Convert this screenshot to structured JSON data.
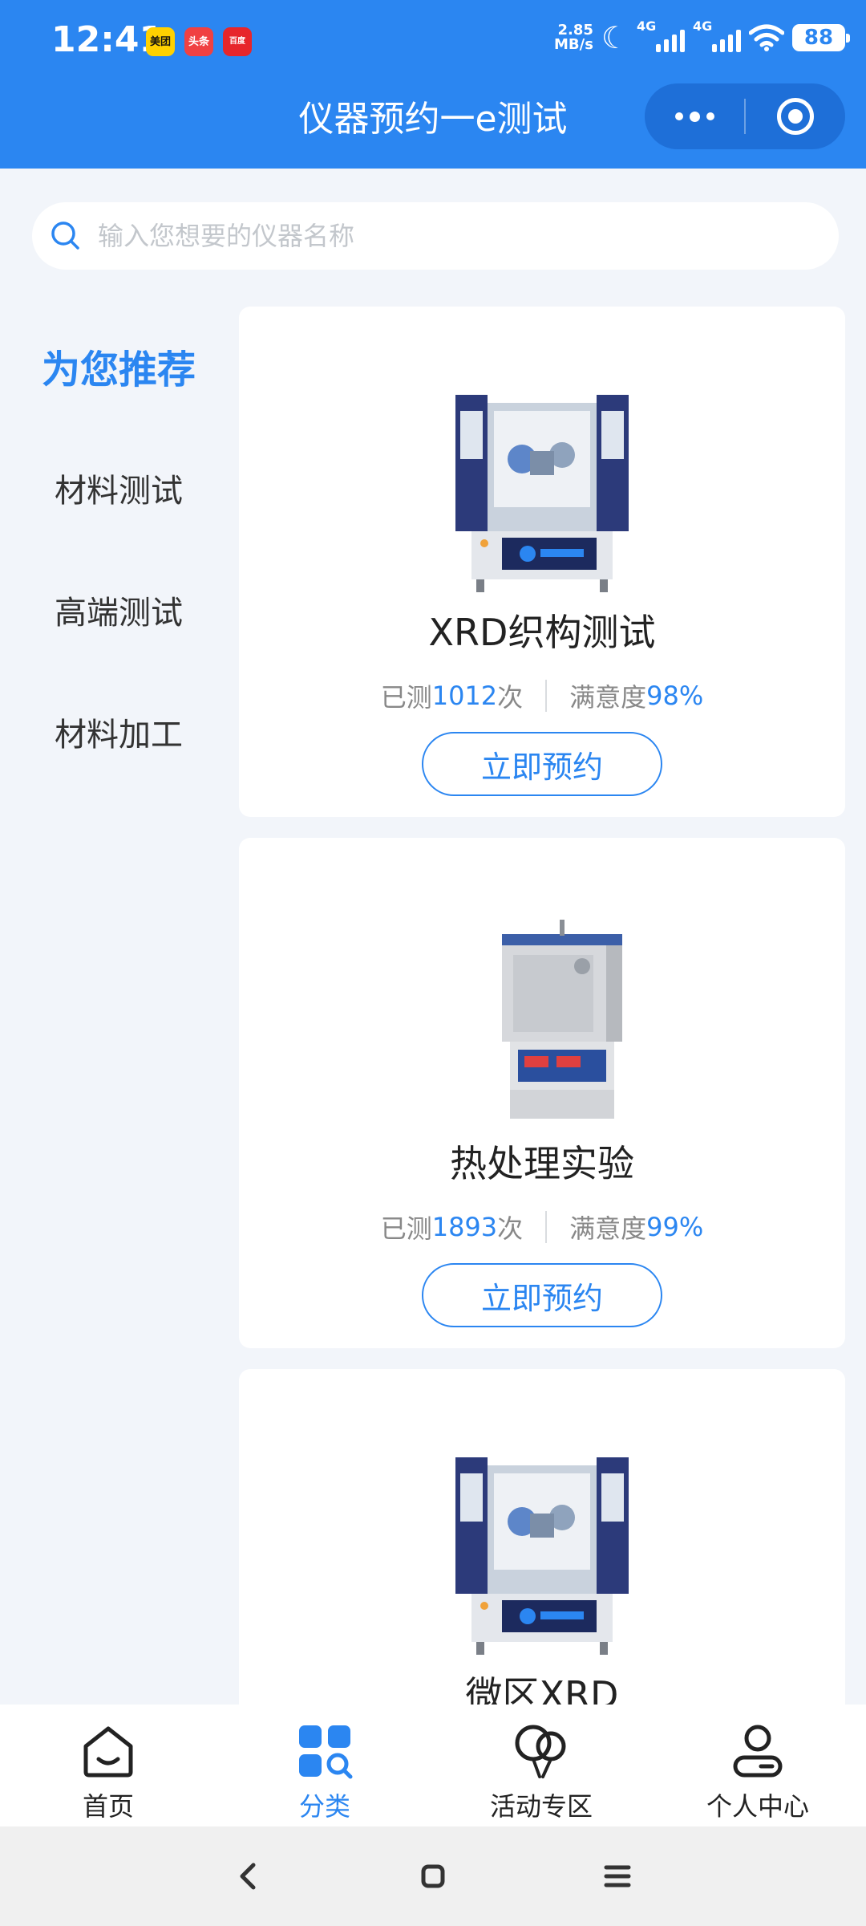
{
  "status_bar": {
    "time": "12:41",
    "apps": [
      "美团",
      "头条",
      "百度"
    ],
    "net_speed_value": "2.85",
    "net_speed_unit": "MB/s",
    "signal_labels": [
      "4G",
      "4G"
    ],
    "battery": "88"
  },
  "header": {
    "title": "仪器预约一e测试"
  },
  "search": {
    "placeholder": "输入您想要的仪器名称"
  },
  "sidebar": {
    "items": [
      {
        "label": "为您推荐",
        "active": true
      },
      {
        "label": "材料测试",
        "active": false
      },
      {
        "label": "高端测试",
        "active": false
      },
      {
        "label": "材料加工",
        "active": false
      }
    ]
  },
  "cards": [
    {
      "name": "XRD织构测试",
      "tested_prefix": "已测",
      "tested_count": "1012",
      "tested_suffix": "次",
      "satisfaction_label": "满意度",
      "satisfaction": "98%",
      "button": "立即预约"
    },
    {
      "name": "热处理实验",
      "tested_prefix": "已测",
      "tested_count": "1893",
      "tested_suffix": "次",
      "satisfaction_label": "满意度",
      "satisfaction": "99%",
      "button": "立即预约"
    },
    {
      "name": "微区XRD"
    }
  ],
  "tabbar": {
    "items": [
      {
        "label": "首页",
        "icon": "home-icon",
        "active": false
      },
      {
        "label": "分类",
        "icon": "category-icon",
        "active": true
      },
      {
        "label": "活动专区",
        "icon": "balloon-icon",
        "active": false
      },
      {
        "label": "个人中心",
        "icon": "user-icon",
        "active": false
      }
    ]
  },
  "colors": {
    "primary": "#2b86f1",
    "background": "#f2f5fa",
    "text": "#222222",
    "muted": "#888888"
  }
}
